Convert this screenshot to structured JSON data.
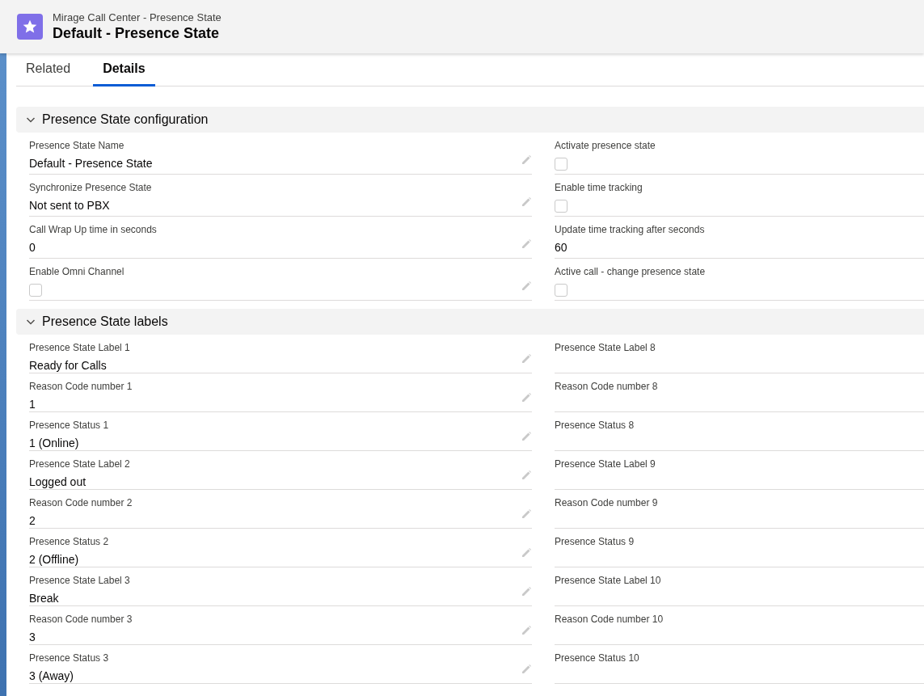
{
  "header": {
    "object_type": "Mirage Call Center - Presence State",
    "title": "Default - Presence State"
  },
  "tabs": [
    {
      "label": "Related",
      "selected": false
    },
    {
      "label": "Details",
      "selected": true
    }
  ],
  "sections": [
    {
      "title": "Presence State configuration",
      "expanded": true,
      "left": [
        {
          "label": "Presence State Name",
          "kind": "text",
          "value": "Default - Presence State",
          "editable": true
        },
        {
          "label": "Synchronize Presence State",
          "kind": "text",
          "value": "Not sent to PBX",
          "editable": true
        },
        {
          "label": "Call Wrap Up time in seconds",
          "kind": "text",
          "value": "0",
          "editable": true
        },
        {
          "label": "Enable Omni Channel",
          "kind": "checkbox",
          "checked": false,
          "editable": true
        }
      ],
      "right": [
        {
          "label": "Activate presence state",
          "kind": "checkbox",
          "checked": false,
          "editable": false
        },
        {
          "label": "Enable time tracking",
          "kind": "checkbox",
          "checked": false,
          "editable": false
        },
        {
          "label": "Update time tracking after seconds",
          "kind": "text",
          "value": "60",
          "editable": false
        },
        {
          "label": "Active call - change presence state",
          "kind": "checkbox",
          "checked": false,
          "editable": false
        }
      ]
    },
    {
      "title": "Presence State labels",
      "expanded": true,
      "left": [
        {
          "label": "Presence State Label 1",
          "kind": "text",
          "value": "Ready for Calls",
          "editable": true
        },
        {
          "label": "Reason Code number 1",
          "kind": "text",
          "value": "1",
          "editable": true
        },
        {
          "label": "Presence Status 1",
          "kind": "text",
          "value": "1 (Online)",
          "editable": true
        },
        {
          "label": "Presence State Label 2",
          "kind": "text",
          "value": "Logged out",
          "editable": true
        },
        {
          "label": "Reason Code number 2",
          "kind": "text",
          "value": "2",
          "editable": true
        },
        {
          "label": "Presence Status 2",
          "kind": "text",
          "value": "2 (Offline)",
          "editable": true
        },
        {
          "label": "Presence State Label 3",
          "kind": "text",
          "value": "Break",
          "editable": true
        },
        {
          "label": "Reason Code number 3",
          "kind": "text",
          "value": "3",
          "editable": true
        },
        {
          "label": "Presence Status 3",
          "kind": "text",
          "value": "3 (Away)",
          "editable": true
        }
      ],
      "right": [
        {
          "label": "Presence State Label 8",
          "kind": "text",
          "editable": false
        },
        {
          "label": "Reason Code number 8",
          "kind": "text",
          "editable": false
        },
        {
          "label": "Presence Status 8",
          "kind": "text",
          "editable": false
        },
        {
          "label": "Presence State Label 9",
          "kind": "text",
          "editable": false
        },
        {
          "label": "Reason Code number 9",
          "kind": "text",
          "editable": false
        },
        {
          "label": "Presence Status 9",
          "kind": "text",
          "editable": false
        },
        {
          "label": "Presence State Label 10",
          "kind": "text",
          "editable": false
        },
        {
          "label": "Reason Code number 10",
          "kind": "text",
          "editable": false
        },
        {
          "label": "Presence Status 10",
          "kind": "text",
          "editable": false
        }
      ]
    }
  ]
}
